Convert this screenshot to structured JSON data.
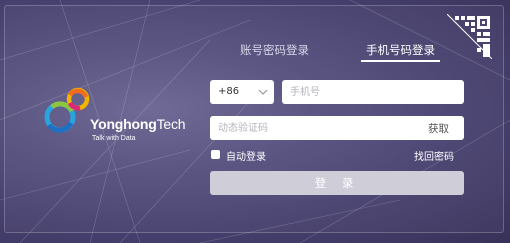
{
  "brand": {
    "name_bold": "Yonghong",
    "name_regular": "Tech",
    "tagline": "Talk with Data"
  },
  "tabs": [
    {
      "label": "账号密码登录",
      "active": false
    },
    {
      "label": "手机号码登录",
      "active": true
    }
  ],
  "phone_login": {
    "country_code": "+86",
    "phone_placeholder": "手机号",
    "code_placeholder": "动态验证码",
    "get_code_label": "获取"
  },
  "options": {
    "auto_login_label": "自动登录",
    "auto_login_checked": false,
    "forgot_password_label": "找回密码"
  },
  "login_button_label": "登 录",
  "icons": {
    "qr": "qr-code-icon",
    "chevron": "chevron-down-icon",
    "logo": "yonghong-logo"
  },
  "colors": {
    "background": "#4b4573",
    "button_disabled": "#cfcdd8",
    "text_light": "#ffffff"
  }
}
